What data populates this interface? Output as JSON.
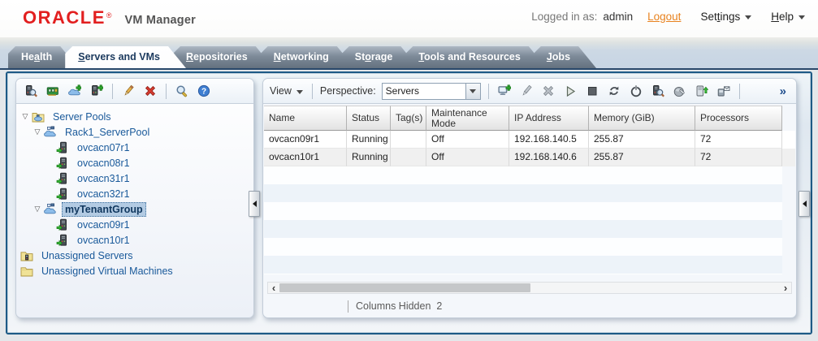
{
  "header": {
    "brand": "ORACLE",
    "brand_mark": "®",
    "product": "VM Manager",
    "logged_in_label": "Logged in as:",
    "user": "admin",
    "logout_label": "Logout",
    "settings": {
      "pre": "Set",
      "key": "t",
      "post": "ings"
    },
    "help": {
      "pre": "",
      "key": "H",
      "post": "elp"
    }
  },
  "tabs": [
    {
      "pre": "He",
      "key": "a",
      "post": "lth",
      "active": false
    },
    {
      "pre": "",
      "key": "S",
      "post": "ervers and VMs",
      "active": true
    },
    {
      "pre": "",
      "key": "R",
      "post": "epositories",
      "active": false
    },
    {
      "pre": "",
      "key": "N",
      "post": "etworking",
      "active": false
    },
    {
      "pre": "St",
      "key": "o",
      "post": "rage",
      "active": false
    },
    {
      "pre": "",
      "key": "T",
      "post": "ools and Resources",
      "active": false
    },
    {
      "pre": "",
      "key": "J",
      "post": "obs",
      "active": false
    }
  ],
  "left_panel": {
    "toolbar": [
      {
        "name": "discover-servers-icon",
        "icon": "discover-servers"
      },
      {
        "name": "ethernet-ports-icon",
        "icon": "ethernet-ports"
      },
      {
        "name": "create-server-pool-icon",
        "icon": "create-server-pool"
      },
      {
        "name": "add-server-icon",
        "icon": "add-server"
      },
      {
        "sep": true
      },
      {
        "name": "edit-icon",
        "icon": "edit"
      },
      {
        "name": "delete-icon",
        "icon": "delete"
      },
      {
        "sep": true
      },
      {
        "name": "search-icon",
        "icon": "search"
      },
      {
        "name": "help-icon",
        "icon": "help"
      }
    ],
    "tree": [
      {
        "level": 0,
        "label": "Server Pools",
        "icon": "folder-pool",
        "expandable": true,
        "selected": false
      },
      {
        "level": 1,
        "label": "Rack1_ServerPool",
        "icon": "server-pool",
        "expandable": true,
        "selected": false
      },
      {
        "level": 2,
        "label": "ovcacn07r1",
        "icon": "server",
        "expandable": false,
        "selected": false
      },
      {
        "level": 2,
        "label": "ovcacn08r1",
        "icon": "server",
        "expandable": false,
        "selected": false
      },
      {
        "level": 2,
        "label": "ovcacn31r1",
        "icon": "server",
        "expandable": false,
        "selected": false
      },
      {
        "level": 2,
        "label": "ovcacn32r1",
        "icon": "server",
        "expandable": false,
        "selected": false
      },
      {
        "level": 1,
        "label": "myTenantGroup",
        "icon": "server-pool",
        "expandable": true,
        "selected": true
      },
      {
        "level": 2,
        "label": "ovcacn09r1",
        "icon": "server",
        "expandable": false,
        "selected": false
      },
      {
        "level": 2,
        "label": "ovcacn10r1",
        "icon": "server",
        "expandable": false,
        "selected": false
      },
      {
        "level": 0,
        "label": "Unassigned Servers",
        "icon": "folder-servers",
        "expandable": false,
        "selected": false
      },
      {
        "level": 0,
        "label": "Unassigned Virtual Machines",
        "icon": "folder",
        "expandable": false,
        "selected": false
      }
    ]
  },
  "content_toolbar": {
    "view_label": "View",
    "perspective": {
      "pre": "",
      "key": "P",
      "post": "erspective:"
    },
    "perspective_value": "Servers",
    "overflow_glyph": "»",
    "icons": [
      {
        "name": "create-vm-icon",
        "icon": "create-vm"
      },
      {
        "name": "edit-gray-icon",
        "icon": "edit-gray"
      },
      {
        "name": "delete-gray-icon",
        "icon": "delete-gray"
      },
      {
        "name": "start-icon",
        "icon": "start"
      },
      {
        "name": "stop-icon",
        "icon": "stop"
      },
      {
        "name": "refresh-icon",
        "icon": "refresh"
      },
      {
        "name": "kill-server-icon",
        "icon": "kill"
      },
      {
        "name": "rediscover-icon",
        "icon": "discover-servers"
      },
      {
        "name": "update-server-icon",
        "icon": "update"
      },
      {
        "name": "upgrade-icon",
        "icon": "upgrade"
      },
      {
        "name": "send-message-icon",
        "icon": "message"
      },
      {
        "sep": true
      }
    ]
  },
  "table": {
    "columns": [
      "Name",
      "Status",
      "Tag(s)",
      "Maintenance Mode",
      "IP Address",
      "Memory (GiB)",
      "Processors"
    ],
    "rows": [
      [
        "ovcacn09r1",
        "Running",
        "",
        "Off",
        "192.168.140.5",
        "255.87",
        "72"
      ],
      [
        "ovcacn10r1",
        "Running",
        "",
        "Off",
        "192.168.140.6",
        "255.87",
        "72"
      ]
    ],
    "footer": {
      "label": "Columns Hidden",
      "value": "2"
    }
  },
  "colors": {
    "oracle_red": "#e21f1f",
    "logout_orange": "#e8821e",
    "frame_border": "#1d5a86",
    "tab_active_text": "#1c3a5e",
    "tree_text": "#19599a",
    "selection_bg": "#b3cbe3",
    "table_alt_row": "#f0f0f0"
  }
}
